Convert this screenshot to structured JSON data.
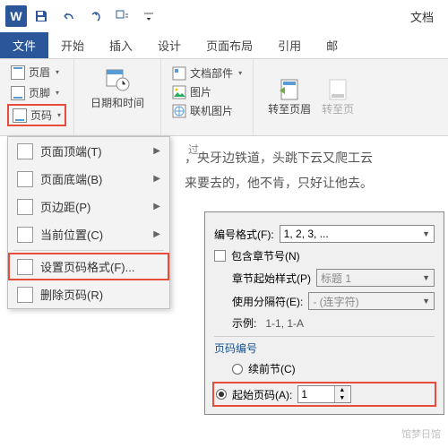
{
  "titlebar": {
    "doc_title": "文档"
  },
  "tabs": [
    "文件",
    "开始",
    "插入",
    "设计",
    "页面布局",
    "引用",
    "邮"
  ],
  "active_tab": 0,
  "hf_group": {
    "header": "页眉",
    "footer": "页脚",
    "pagenum": "页码"
  },
  "datetime_label": "日期和时间",
  "insert_group": {
    "parts": "文档部件",
    "picture": "图片",
    "online_pic": "联机图片"
  },
  "goto": {
    "header": "转至页眉",
    "footer": "转至页"
  },
  "dropdown": {
    "top": "页面顶端(T)",
    "bottom": "页面底端(B)",
    "margin": "页边距(P)",
    "current": "当前位置(C)",
    "format": "设置页码格式(F)...",
    "remove": "删除页码(R)"
  },
  "doc_text": {
    "ruler": "过",
    "line1": "，央牙边铁道，头跳下云又爬工云",
    "line2": "来要去的，他不肯，只好让他去。"
  },
  "dialog": {
    "format_label": "编号格式(F):",
    "format_value": "1, 2, 3, ...",
    "include_chapter": "包含章节号(N)",
    "chapter_style_label": "章节起始样式(P)",
    "chapter_style_value": "标题 1",
    "separator_label": "使用分隔符(E):",
    "separator_value": "- (连字符)",
    "example_label": "示例:",
    "example_value": "1-1, 1-A",
    "pagenum_section": "页码编号",
    "continue": "续前节(C)",
    "start_at": "起始页码(A):",
    "start_value": "1"
  },
  "watermark": "馆梦日馆"
}
